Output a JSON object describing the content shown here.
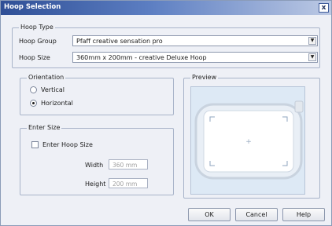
{
  "window": {
    "title": "Hoop Selection",
    "close_glyph": "x"
  },
  "hoop_type": {
    "legend": "Hoop Type",
    "group_label": "Hoop Group",
    "group_value": "Pfaff creative sensation pro",
    "size_label": "Hoop Size",
    "size_value": "360mm x 200mm - creative Deluxe Hoop",
    "dropdown_glyph": "▼"
  },
  "orientation": {
    "legend": "Orientation",
    "options": [
      {
        "label": "Vertical",
        "checked": false
      },
      {
        "label": "Horizontal",
        "checked": true
      }
    ]
  },
  "enter_size": {
    "legend": "Enter Size",
    "checkbox_label": "Enter Hoop Size",
    "checked": false,
    "width_label": "Width",
    "width_value": "360 mm",
    "height_label": "Height",
    "height_value": "200 mm"
  },
  "preview": {
    "legend": "Preview",
    "center_marker": "+"
  },
  "buttons": {
    "ok": "OK",
    "cancel": "Cancel",
    "help": "Help"
  },
  "colors": {
    "titlebar_start": "#2f4f96",
    "dialog_bg": "#eef0f6",
    "preview_bg": "#dde9f5"
  }
}
